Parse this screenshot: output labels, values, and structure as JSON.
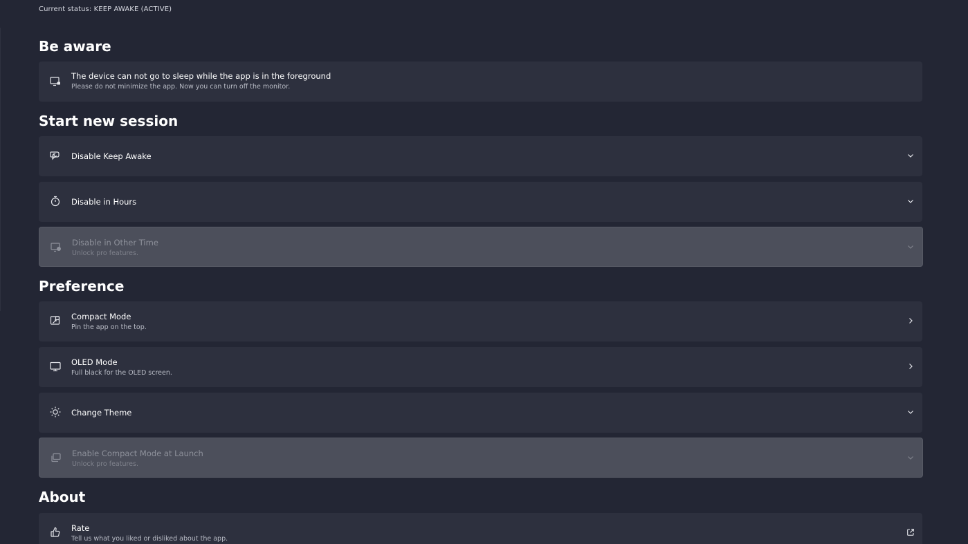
{
  "status": "Current status: KEEP AWAKE (ACTIVE)",
  "sections": {
    "be_aware": "Be aware",
    "start_new_session": "Start new session",
    "preference": "Preference",
    "about": "About"
  },
  "cards": {
    "foreground": {
      "title": "The device can not go to sleep while the app is in the foreground",
      "subtitle": "Please do not minimize the app. Now you can turn off the monitor.",
      "icon": "monitor-lock-icon"
    },
    "disable_keep_awake": {
      "title": "Disable Keep Awake",
      "icon": "sleep-chat-icon",
      "control": "chevron-down-icon"
    },
    "disable_in_hours": {
      "title": "Disable in Hours",
      "icon": "stopwatch-icon",
      "control": "chevron-down-icon"
    },
    "disable_other_time": {
      "title": "Disable in Other Time",
      "subtitle": "Unlock pro features.",
      "icon": "monitor-clock-icon",
      "control": "chevron-down-icon"
    },
    "compact_mode": {
      "title": "Compact Mode",
      "subtitle": "Pin the app on the top.",
      "icon": "pin-window-icon",
      "control": "chevron-right-icon"
    },
    "oled_mode": {
      "title": "OLED Mode",
      "subtitle": "Full black for the OLED screen.",
      "icon": "desktop-icon",
      "control": "chevron-right-icon"
    },
    "change_theme": {
      "title": "Change Theme",
      "icon": "sun-icon",
      "control": "chevron-down-icon"
    },
    "compact_at_launch": {
      "title": "Enable Compact Mode at Launch",
      "subtitle": "Unlock pro features.",
      "icon": "windows-stack-icon",
      "control": "chevron-down-icon"
    },
    "rate": {
      "title": "Rate",
      "subtitle": "Tell us what you liked or disliked about the app.",
      "icon": "thumbs-up-icon",
      "control": "open-external-icon"
    }
  },
  "colors": {
    "background": "#232634",
    "card": "#2d303e",
    "card_disabled": "#4c4f5b",
    "text": "#ffffff",
    "subtext": "#b9bcc6"
  }
}
